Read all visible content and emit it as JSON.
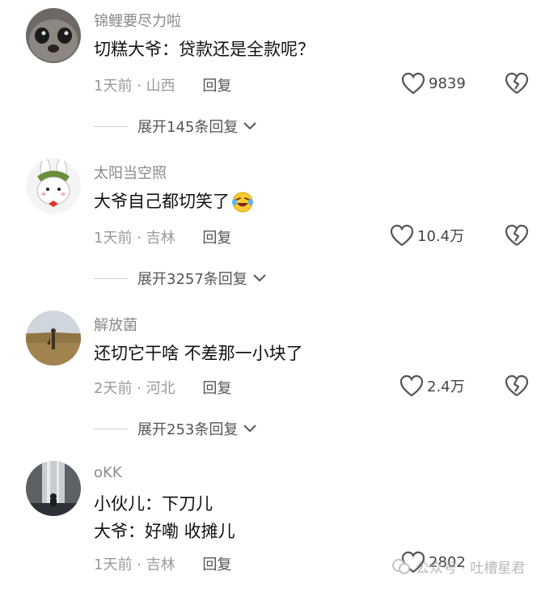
{
  "comments": [
    {
      "username": "锦鲤要尽力啦",
      "text_lines": [
        "切糕大爷：贷款还是全款呢？"
      ],
      "time": "1天前",
      "location": "山西",
      "reply_label": "回复",
      "likes": "9839",
      "expand_label": "展开145条回复",
      "avatar_icon": "cat-face-avatar"
    },
    {
      "username": "太阳当空照",
      "text_lines": [
        "大爷自己都切笑了"
      ],
      "emoji": "laughing-tears-emoji",
      "time": "1天前",
      "location": "吉林",
      "reply_label": "回复",
      "likes": "10.4万",
      "expand_label": "展开3257条回复",
      "avatar_icon": "rabbit-avatar"
    },
    {
      "username": "解放菌",
      "text_lines": [
        "还切它干啥 不差那一小块了"
      ],
      "time": "2天前",
      "location": "河北",
      "reply_label": "回复",
      "likes": "2.4万",
      "expand_label": "展开253条回复",
      "avatar_icon": "desert-landscape-avatar"
    },
    {
      "username": "oKK",
      "text_lines": [
        "小伙儿：下刀儿",
        "大爷：好嘞 收摊儿"
      ],
      "time": "1天前",
      "location": "吉林",
      "reply_label": "回复",
      "likes": "2802",
      "avatar_icon": "waterfall-person-avatar"
    }
  ],
  "separator": "·",
  "watermark": "公众号 · 吐槽星君",
  "colors": {
    "text": "#111111",
    "muted": "#9a9a9a",
    "username": "#8a8a8a"
  }
}
